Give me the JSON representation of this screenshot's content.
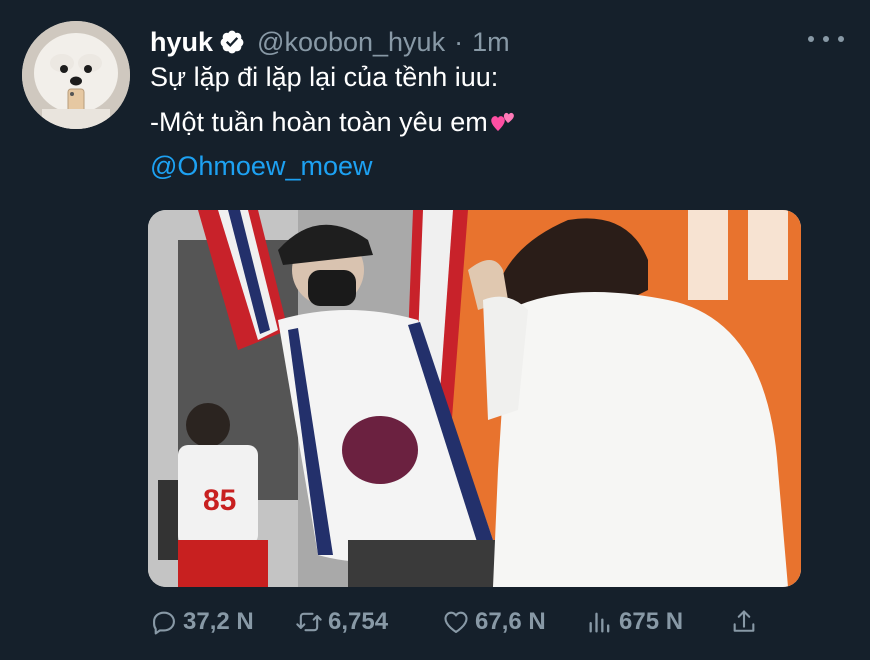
{
  "tweet": {
    "display_name": "hyuk",
    "handle": "@koobon_hyuk",
    "separator": "·",
    "time": "1m",
    "text_line1": "Sự lặp đi lặp lại của tềnh iuu:",
    "text_line2": "-Một tuần hoàn toàn yêu em",
    "mention": "@Ohmoew_moew",
    "verified": true
  },
  "actions": {
    "replies": "37,2 N",
    "retweets": "6,754",
    "likes": "67,6 N",
    "views": "675 N"
  },
  "icons": {
    "verified": "verified-badge-icon",
    "more": "more-options-icon",
    "reply": "reply-icon",
    "retweet": "retweet-icon",
    "like": "heart-icon",
    "views": "views-chart-icon",
    "share": "share-icon",
    "emoji": "two-hearts-emoji"
  },
  "colors": {
    "background": "#15202b",
    "text": "#ffffff",
    "secondary": "#8899a6",
    "link": "#1da1f2",
    "emoji": "#ff4fa3"
  }
}
